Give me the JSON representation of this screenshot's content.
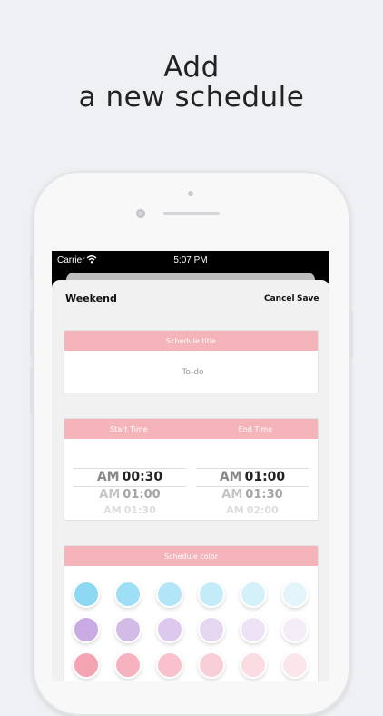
{
  "headline": {
    "line1": "Add",
    "line2": "a new schedule"
  },
  "status_bar": {
    "carrier": "Carrier",
    "time": "5:07 PM"
  },
  "nav": {
    "title": "Weekend",
    "cancel_label": "Cancel",
    "save_label": "Save"
  },
  "schedule_title": {
    "header": "Schedule title",
    "placeholder": "To-do"
  },
  "time": {
    "start_header": "Start Time",
    "end_header": "End Time",
    "start": {
      "selected": {
        "ampm": "AM",
        "time": "00:30"
      },
      "next": {
        "ampm": "AM",
        "time": "01:00"
      },
      "next2": {
        "ampm": "AM",
        "time": "01:30"
      }
    },
    "end": {
      "selected": {
        "ampm": "AM",
        "time": "01:00"
      },
      "next": {
        "ampm": "AM",
        "time": "01:30"
      },
      "next2": {
        "ampm": "AM",
        "time": "02:00"
      }
    }
  },
  "schedule_color": {
    "header": "Schedule color",
    "rows": [
      [
        "#8dd9f4",
        "#9fdff5",
        "#b2e6f6",
        "#c3ecf8",
        "#d4f1f9",
        "#e3f5fa"
      ],
      [
        "#c8abe3",
        "#d3bbe8",
        "#ddc9ed",
        "#e6d7f1",
        "#eee3f5",
        "#f4edf8"
      ],
      [
        "#f4a3b2",
        "#f6b2be",
        "#f8c1cb",
        "#f9cfd7",
        "#fadce2",
        "#fbe7eb"
      ]
    ]
  }
}
